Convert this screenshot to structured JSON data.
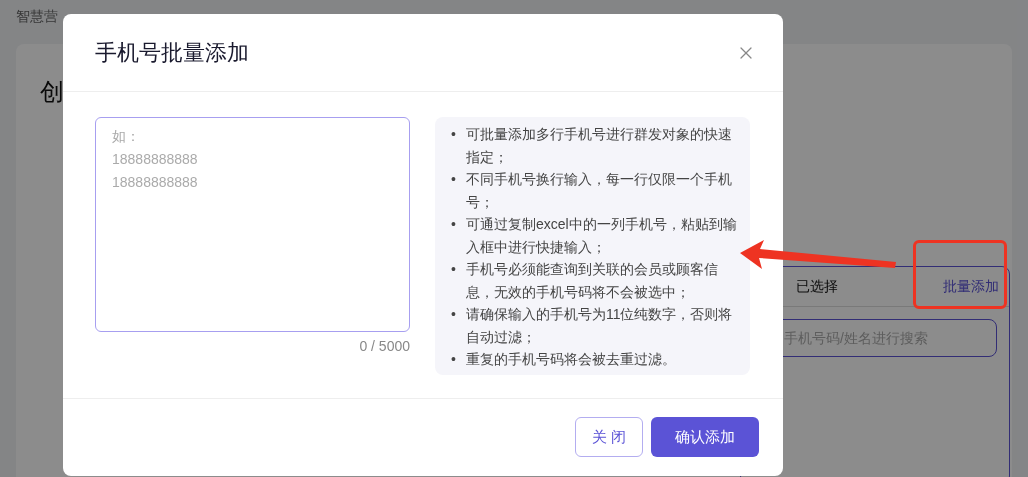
{
  "breadcrumb": [
    {
      "label": "智慧营",
      "current": false
    }
  ],
  "page_title": "创",
  "selection_panel": {
    "tab": "已选择",
    "batch_add_link": "批量添加",
    "search": {
      "placeholder": "手机号码/姓名进行搜索"
    }
  },
  "dialog": {
    "title": "手机号批量添加",
    "textarea": {
      "placeholder_lines": [
        "如：",
        "18888888888",
        "18888888888"
      ],
      "counter": "0 / 5000"
    },
    "tips": [
      {
        "bullet": "•",
        "text": "可批量添加多行手机号进行群发对象的快速指定；"
      },
      {
        "bullet": "•",
        "text": "不同手机号换行输入，每一行仅限一个手机号；"
      },
      {
        "bullet": "•",
        "text": "可通过复制excel中的一列手机号，粘贴到输入框中进行快捷输入；"
      },
      {
        "bullet": "•",
        "text": "手机号必须能查询到关联的会员或顾客信息，无效的手机号码将不会被选中；"
      },
      {
        "bullet": "•",
        "text": "请确保输入的手机号为11位纯数字，否则将自动过滤；"
      },
      {
        "bullet": "•",
        "text": "重复的手机号码将会被去重过滤。"
      }
    ],
    "buttons": [
      {
        "label": "关 闭",
        "kind": "secondary"
      },
      {
        "label": "确认添加",
        "kind": "primary"
      }
    ]
  }
}
